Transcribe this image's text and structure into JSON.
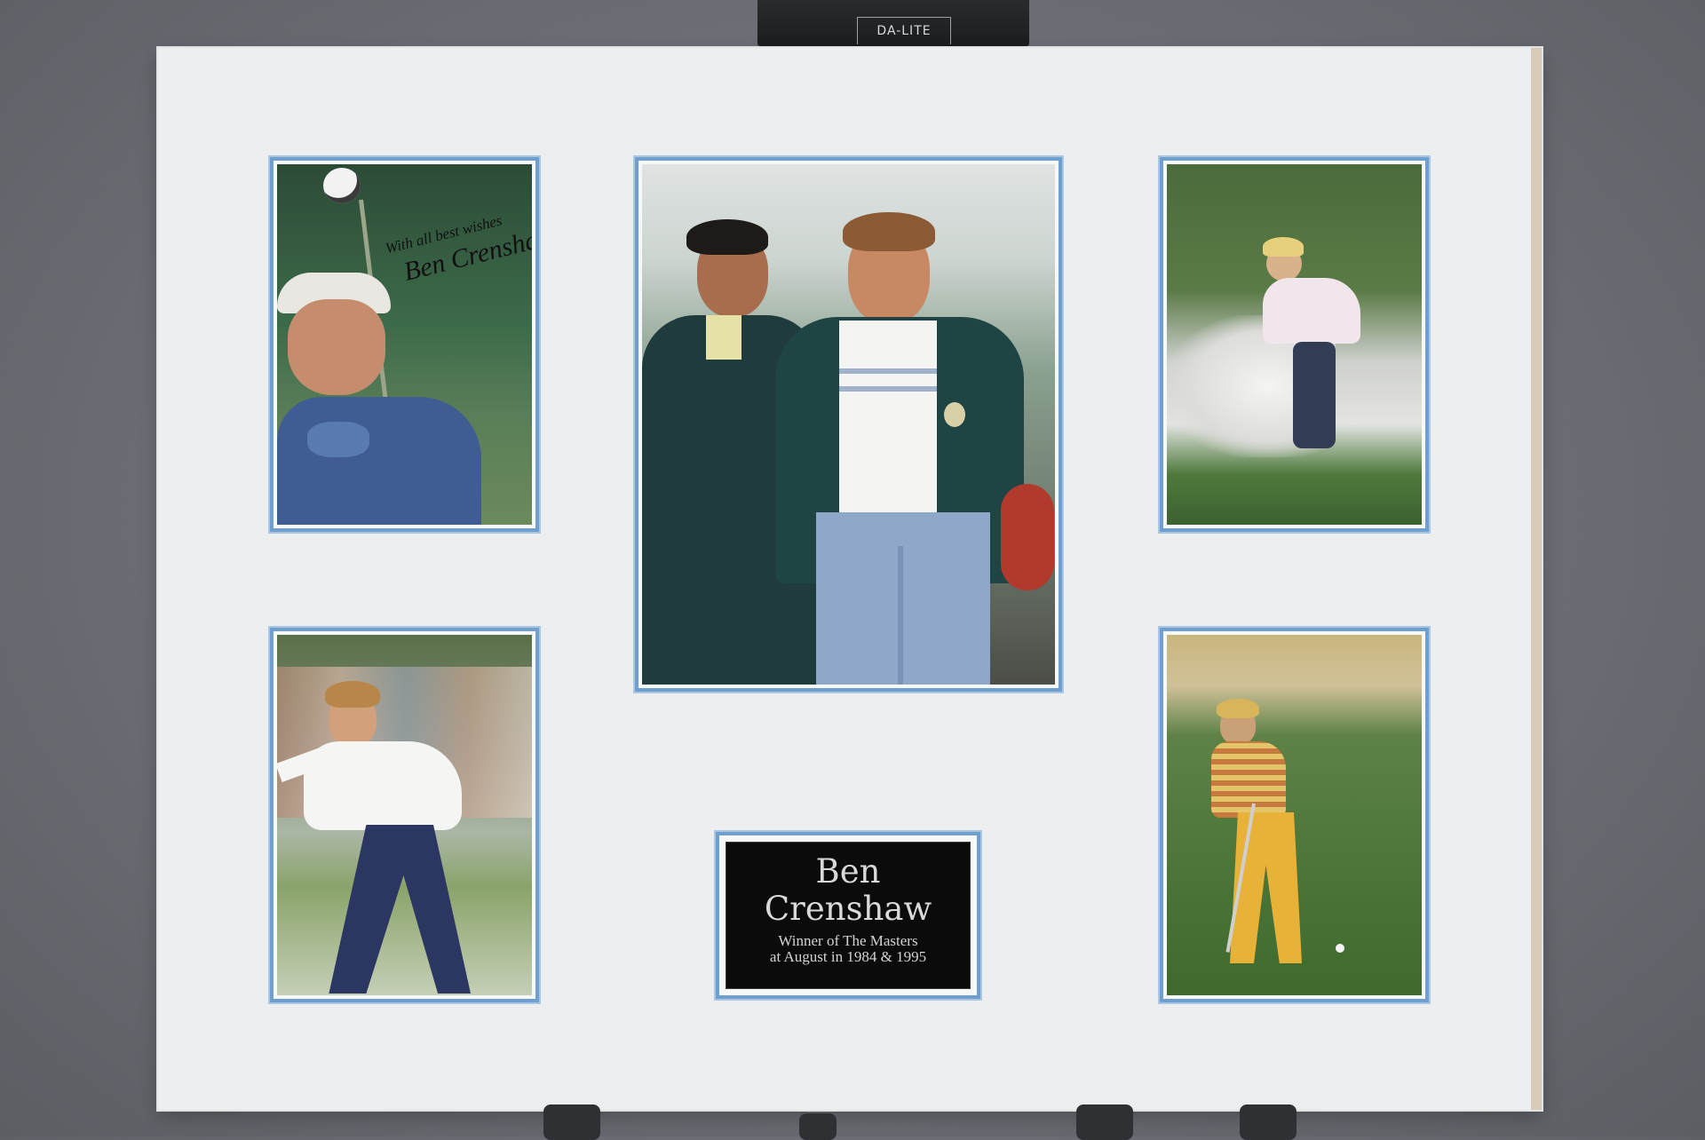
{
  "stand": {
    "brand": "DA-LITE"
  },
  "signature": {
    "line1": "With all best wishes",
    "line2": "Ben Crenshaw"
  },
  "plaque": {
    "name_line1": "Ben",
    "name_line2": "Crenshaw",
    "subtitle_line1": "Winner of The Masters",
    "subtitle_line2": "at August in 1984 & 1995"
  }
}
